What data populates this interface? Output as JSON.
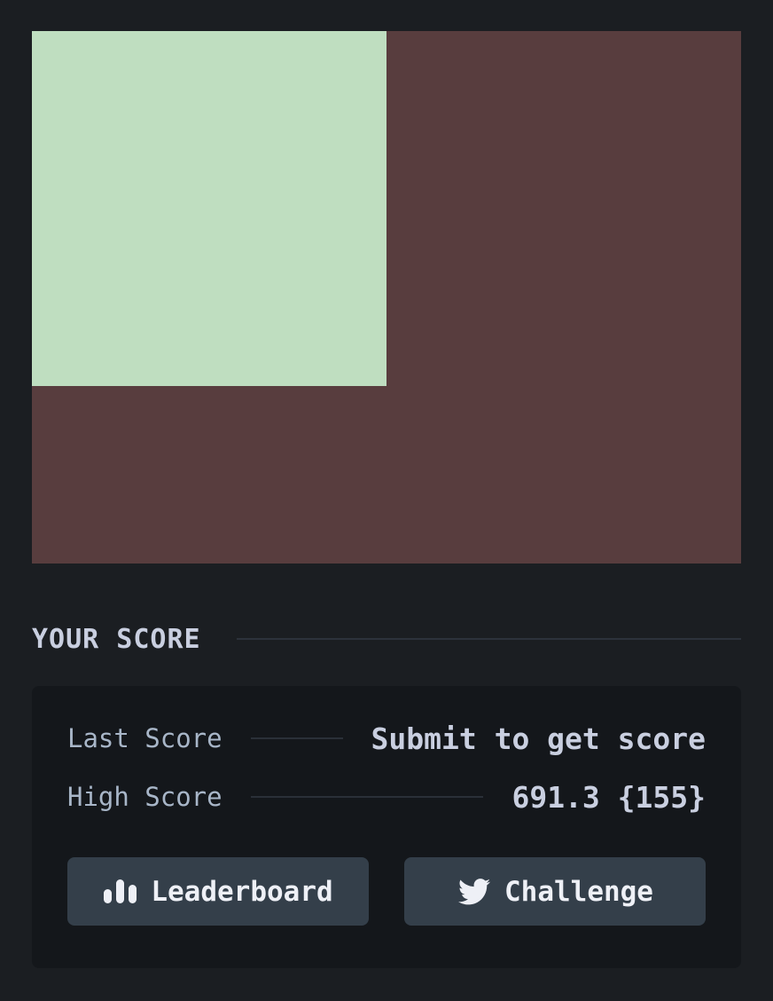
{
  "game": {
    "canvas_color": "#583d3e",
    "target_color": "#bfdec0"
  },
  "score_section": {
    "title": "YOUR SCORE",
    "last_score_label": "Last Score",
    "last_score_value": "Submit to get score",
    "high_score_label": "High Score",
    "high_score_value": "691.3 {155}"
  },
  "buttons": {
    "leaderboard_label": "Leaderboard",
    "leaderboard_icon": "bar-chart-icon",
    "challenge_label": "Challenge",
    "challenge_icon": "twitter-icon"
  }
}
